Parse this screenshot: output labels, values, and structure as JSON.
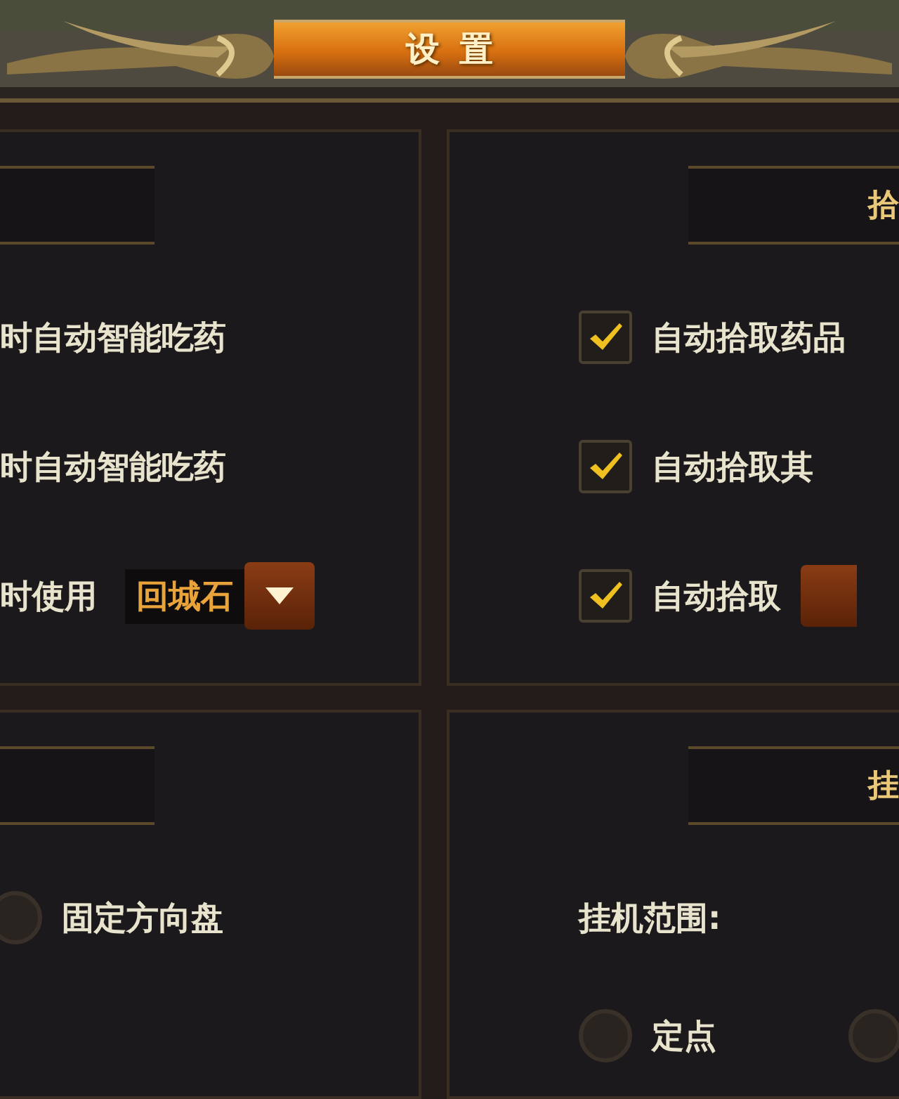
{
  "title": "设置",
  "panels": [
    {
      "rows": [
        {
          "kind": "text",
          "label": "时自动智能吃药"
        },
        {
          "kind": "text",
          "label": "时自动智能吃药"
        },
        {
          "kind": "dropdown",
          "label": "时使用",
          "value": "回城石"
        }
      ]
    },
    {
      "header": "拾",
      "rows": [
        {
          "kind": "checkbox",
          "label": "自动拾取药品",
          "checked": true
        },
        {
          "kind": "checkbox",
          "label": "自动拾取其",
          "checked": true
        },
        {
          "kind": "checkbox",
          "label": "自动拾取",
          "checked": true,
          "dropdown": true
        }
      ]
    },
    {
      "rows": [
        {
          "kind": "radio",
          "label": "固定方向盘",
          "selected": false
        }
      ]
    },
    {
      "header": "挂",
      "rows": [
        {
          "kind": "text",
          "label": "挂机范围:"
        },
        {
          "kind": "radios",
          "options": [
            {
              "label": "定点",
              "selected": false
            },
            {
              "selected": false
            }
          ]
        }
      ]
    }
  ]
}
